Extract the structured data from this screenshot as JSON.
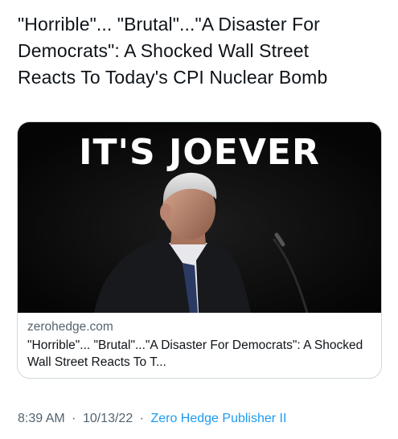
{
  "tweet": {
    "text": "\"Horrible\"... \"Brutal\"...\"A Disaster For\nDemocrats\": A Shocked Wall Street\nReacts To Today's CPI Nuclear Bomb"
  },
  "card": {
    "image_headline": "IT'S JOEVER",
    "domain": "zerohedge.com",
    "title": "\"Horrible\"... \"Brutal\"...\"A Disaster For Democrats\": A Shocked Wall Street Reacts To T..."
  },
  "meta": {
    "time": "8:39 AM",
    "separator": "·",
    "date": "10/13/22",
    "source": "Zero Hedge Publisher II"
  },
  "colors": {
    "text_primary": "#0f1419",
    "text_secondary": "#536471",
    "link": "#1d9bf0",
    "card_border": "#cfd9de",
    "image_background": "#0b0b0b"
  }
}
